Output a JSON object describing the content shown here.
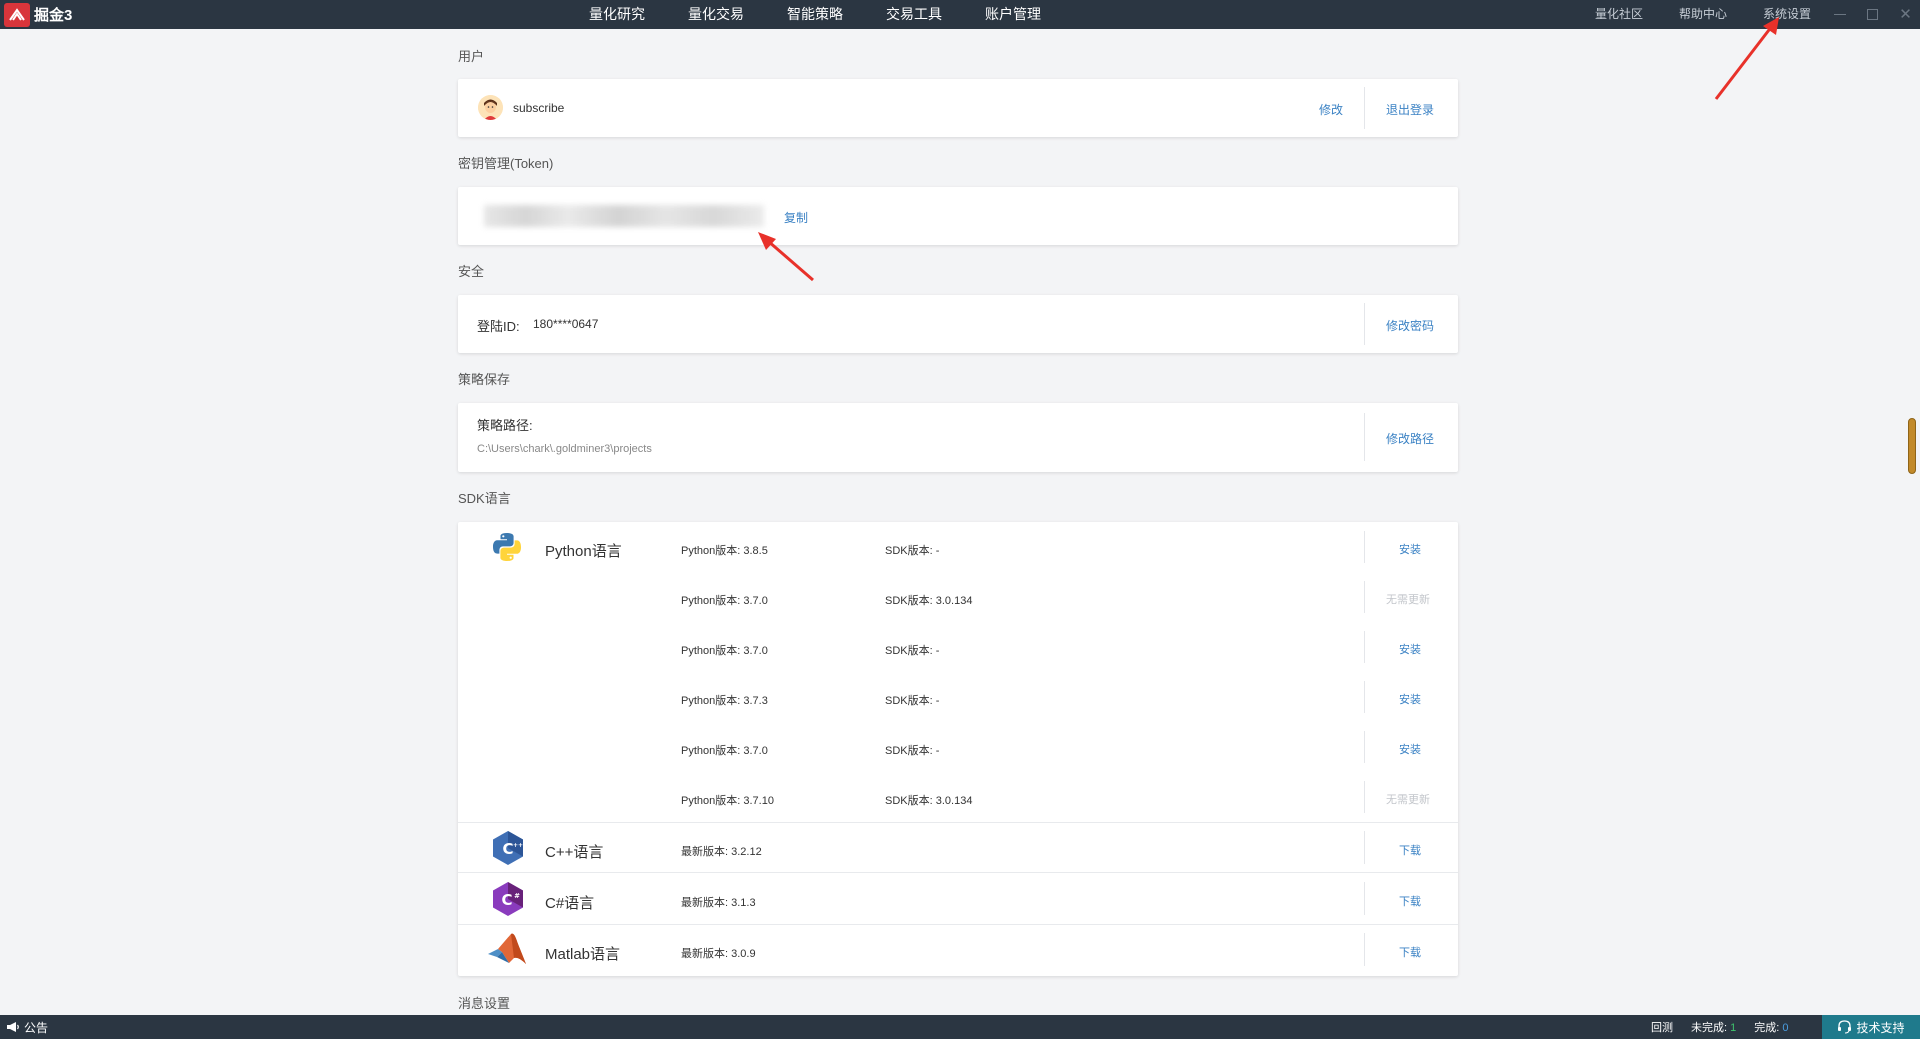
{
  "app": {
    "logo_text": "掘金3"
  },
  "nav": [
    "量化研究",
    "量化交易",
    "智能策略",
    "交易工具",
    "账户管理"
  ],
  "top_right_links": [
    "量化社区",
    "帮助中心",
    "系统设置"
  ],
  "window_controls": {
    "close_glyph": "✕"
  },
  "sections": {
    "user": {
      "title": "用户",
      "username": "subscribe",
      "edit_label": "修改",
      "logout_label": "退出登录"
    },
    "token": {
      "title": "密钥管理(Token)",
      "copy_label": "复制"
    },
    "security": {
      "title": "安全",
      "login_id_label": "登陆ID:",
      "login_id_value": "180****0647",
      "change_password_label": "修改密码"
    },
    "strategy_save": {
      "title": "策略保存",
      "path_label": "策略路径:",
      "path_value": "C:\\Users\\chark\\.goldminer3\\projects",
      "change_path_label": "修改路径"
    },
    "sdk": {
      "title": "SDK语言",
      "python": {
        "name": "Python语言",
        "rows": [
          {
            "python_version": "Python版本: 3.8.5",
            "sdk_version": "SDK版本: -",
            "action": "安装",
            "enabled": true
          },
          {
            "python_version": "Python版本: 3.7.0",
            "sdk_version": "SDK版本: 3.0.134",
            "action": "无需更新",
            "enabled": false
          },
          {
            "python_version": "Python版本: 3.7.0",
            "sdk_version": "SDK版本: -",
            "action": "安装",
            "enabled": true
          },
          {
            "python_version": "Python版本: 3.7.3",
            "sdk_version": "SDK版本: -",
            "action": "安装",
            "enabled": true
          },
          {
            "python_version": "Python版本: 3.7.0",
            "sdk_version": "SDK版本: -",
            "action": "安装",
            "enabled": true
          },
          {
            "python_version": "Python版本: 3.7.10",
            "sdk_version": "SDK版本: 3.0.134",
            "action": "无需更新",
            "enabled": false
          }
        ]
      },
      "others": [
        {
          "name": "C++语言",
          "version": "最新版本: 3.2.12",
          "action": "下载",
          "icon_letter": "C"
        },
        {
          "name": "C#语言",
          "version": "最新版本: 3.1.3",
          "action": "下载",
          "icon_letter": "C"
        },
        {
          "name": "Matlab语言",
          "version": "最新版本: 3.0.9",
          "action": "下载"
        }
      ]
    },
    "message": {
      "title": "消息设置"
    }
  },
  "bottom": {
    "notice_label": "公告",
    "backtest_label": "回测",
    "unfinished_label": "未完成:",
    "unfinished_count": "1",
    "finished_label": "完成:",
    "finished_count": "0",
    "support_label": "技术支持"
  },
  "colors": {
    "topbar": "#2b3642",
    "link": "#3b82c4",
    "annotation_arrow": "#e8312a",
    "logo_red": "#d8353b"
  }
}
